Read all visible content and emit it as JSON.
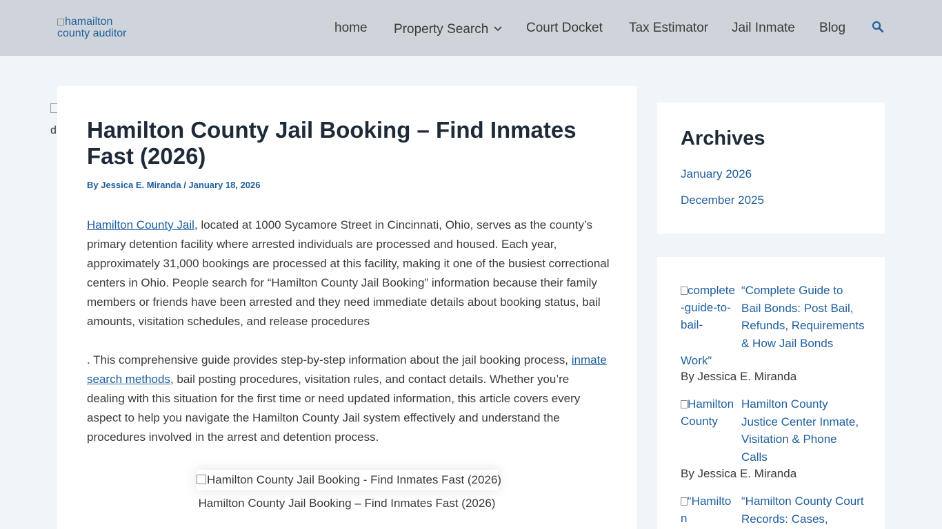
{
  "header": {
    "logo_alt": "hamailton county auditor",
    "nav": [
      {
        "label": "home"
      },
      {
        "label": "Property Search"
      },
      {
        "label": "Court Docket"
      },
      {
        "label": "Tax Estimator"
      },
      {
        "label": "Jail Inmate"
      },
      {
        "label": "Blog"
      }
    ],
    "search_icon": "search-icon"
  },
  "left_image_alt_fragment": "d",
  "article": {
    "title": "Hamilton County Jail Booking – Find Inmates Fast (2026)",
    "meta": {
      "by": "By ",
      "author": "Jessica E. Miranda",
      "sep": " / ",
      "date": "January 18, 2026"
    },
    "p1": {
      "link": "Hamilton County Jail",
      "text": ", located at 1000 Sycamore Street in Cincinnati, Ohio, serves as the county’s primary detention facility where arrested individuals are processed and housed. Each year, approximately 31,000 bookings are processed at this facility, making it one of the busiest correctional centers in Ohio. People search for “Hamilton County Jail Booking” information because their family members or friends have been arrested and they need immediate details about booking status, bail amounts, visitation schedules, and release procedures"
    },
    "p2": {
      "lead": ". This comprehensive guide provides step-by-step information about the jail booking process, ",
      "link": "inmate search methods",
      "text": ", bail posting procedures, visitation rules, and contact details. Whether you’re dealing with this situation for the first time or need updated information, this article covers every aspect to help you navigate the Hamilton County Jail system effectively and understand the procedures involved in the arrest and detention process."
    },
    "figure_alt": "Hamilton County Jail Booking - Find Inmates Fast (2026)",
    "caption": "Hamilton County Jail Booking – Find Inmates Fast (2026)"
  },
  "sidebar": {
    "archives": {
      "title": "Archives",
      "links": [
        "January 2026",
        "December 2025"
      ]
    },
    "posts": [
      {
        "thumb_alt": "complete-guide-to-bail-",
        "title": "“Complete Guide to Bail Bonds: Post Bail, Refunds, Requirements & How Jail Bonds",
        "title_tail": "Work”",
        "by": "By Jessica E. Miranda"
      },
      {
        "thumb_alt": "Hamilton County",
        "title": "Hamilton County Justice Center Inmate, Visitation & Phone Calls",
        "by": "By Jessica E. Miranda"
      },
      {
        "thumb_alt": "“Hamilton",
        "title": "“Hamilton County Court Records: Cases,"
      }
    ]
  }
}
